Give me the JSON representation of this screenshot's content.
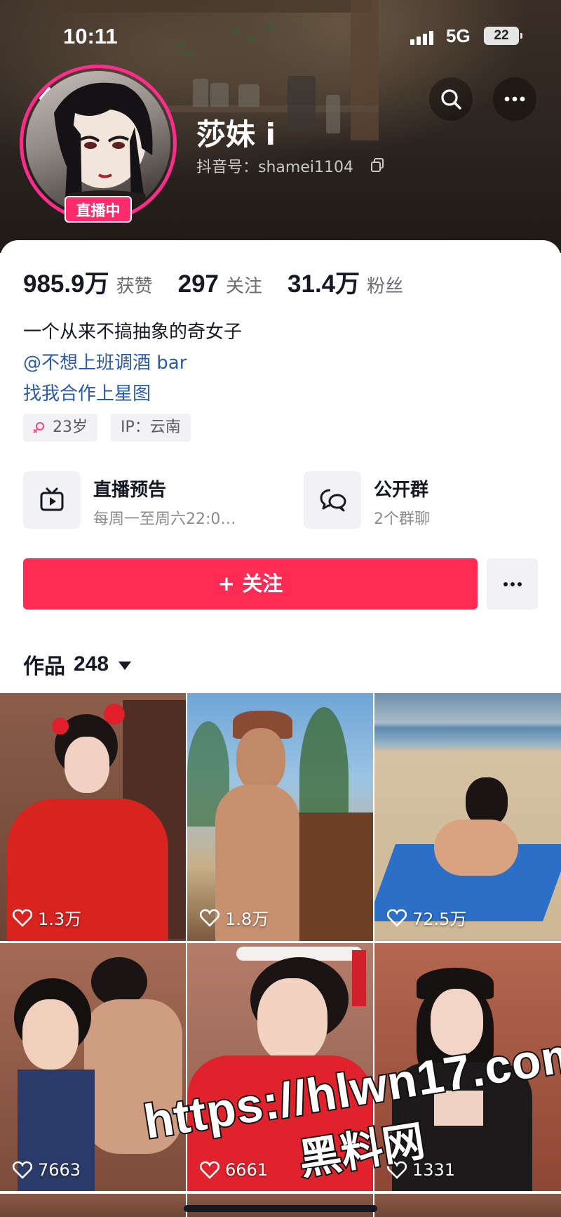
{
  "status_bar": {
    "time": "10:11",
    "network": "5G",
    "battery": "22"
  },
  "header": {
    "nickname": "莎妹 i",
    "douyin_id": "抖音号：shamei1104",
    "live_badge": "直播中"
  },
  "stats": [
    {
      "value": "985.9万",
      "label": "获赞"
    },
    {
      "value": "297",
      "label": "关注"
    },
    {
      "value": "31.4万",
      "label": "粉丝"
    }
  ],
  "bio": {
    "line1": "一个从来不搞抽象的奇女子",
    "line2": "@不想上班调酒 bar",
    "line3": "找我合作上星图"
  },
  "tags": {
    "age": "23岁",
    "ip": "IP：云南"
  },
  "features": {
    "live": {
      "title": "直播预告",
      "subtitle": "每周一至周六22:0…"
    },
    "group": {
      "title": "公开群",
      "subtitle": "2个群聊"
    }
  },
  "actions": {
    "follow_label": "+ 关注"
  },
  "works": {
    "label": "作品",
    "count": "248",
    "items": [
      {
        "likes": "1.3万"
      },
      {
        "likes": "1.8万"
      },
      {
        "likes": "72.5万"
      },
      {
        "likes": "7663"
      },
      {
        "likes": "6661"
      },
      {
        "likes": "1331"
      }
    ]
  },
  "watermark": {
    "url": "https://hlwn17.com",
    "name": "黑料网"
  },
  "colors": {
    "accent": "#fe2c55",
    "live_pink": "#fe2c8a",
    "link_blue": "#2b5aa6"
  }
}
